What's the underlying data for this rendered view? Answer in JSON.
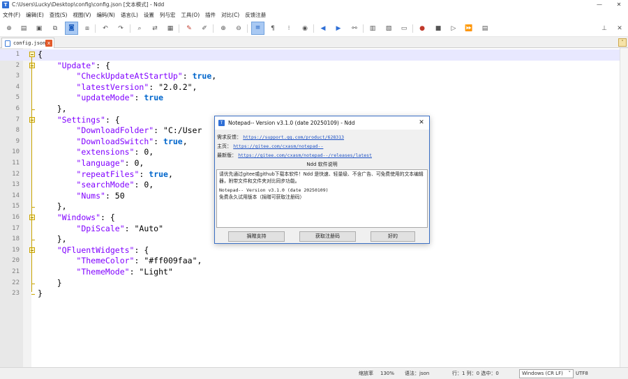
{
  "window": {
    "title": "C:\\Users\\Lucky\\Desktop\\config\\config.json [文本模式] - Ndd",
    "app_icon_letter": "T",
    "minimize_glyph": "—",
    "close_glyph": "✕"
  },
  "menu": [
    "文件(F)",
    "编辑(E)",
    "查找(S)",
    "视图(V)",
    "编码(N)",
    "语言(L)",
    "设置",
    "列与宏",
    "工具(O)",
    "插件",
    "对比(C)",
    "反馈注册"
  ],
  "toolbar_icons": [
    "new-file-icon",
    "open-file-icon",
    "save-icon",
    "save-all-icon",
    "close-icon",
    "close-all-icon",
    "undo-icon",
    "redo-icon",
    "find-icon",
    "replace-icon",
    "find-in-files-icon",
    "highlight-icon",
    "clear-highlight-icon",
    "zoom-in-icon",
    "zoom-out-icon",
    "word-wrap-icon",
    "show-symbols-icon",
    "indent-guide-icon",
    "macro-record-icon",
    "prev-icon",
    "next-icon",
    "compare-icon",
    "column-icon",
    "bookmark-icon",
    "monitor-icon",
    "record-icon",
    "stop-icon",
    "play-icon",
    "play-multiple-icon",
    "save-macro-icon",
    "pin-icon",
    "window-close-icon"
  ],
  "tab": {
    "label": "config.json",
    "close_glyph": "x",
    "dropdown_glyph": "˅"
  },
  "editor": {
    "lines": [
      {
        "n": "1",
        "text": "{"
      },
      {
        "n": "2",
        "text": "    \"Update\": {"
      },
      {
        "n": "3",
        "text": "        \"CheckUpdateAtStartUp\": true,"
      },
      {
        "n": "4",
        "text": "        \"latestVersion\": \"2.0.2\","
      },
      {
        "n": "5",
        "text": "        \"updateMode\": true"
      },
      {
        "n": "6",
        "text": "    },"
      },
      {
        "n": "7",
        "text": "    \"Settings\": {"
      },
      {
        "n": "8",
        "text": "        \"DownloadFolder\": \"C:/User"
      },
      {
        "n": "9",
        "text": "        \"DownloadSwitch\": true,"
      },
      {
        "n": "10",
        "text": "        \"extensions\": 0,"
      },
      {
        "n": "11",
        "text": "        \"language\": 0,"
      },
      {
        "n": "12",
        "text": "        \"repeatFiles\": true,"
      },
      {
        "n": "13",
        "text": "        \"searchMode\": 0,"
      },
      {
        "n": "14",
        "text": "        \"Nums\": 50"
      },
      {
        "n": "15",
        "text": "    },"
      },
      {
        "n": "16",
        "text": "    \"Windows\": {"
      },
      {
        "n": "17",
        "text": "        \"DpiScale\": \"Auto\""
      },
      {
        "n": "18",
        "text": "    },"
      },
      {
        "n": "19",
        "text": "    \"QFluentWidgets\": {"
      },
      {
        "n": "20",
        "text": "        \"ThemeColor\": \"#ff009faa\","
      },
      {
        "n": "21",
        "text": "        \"ThemeMode\": \"Light\""
      },
      {
        "n": "22",
        "text": "    }"
      },
      {
        "n": "23",
        "text": "}"
      }
    ],
    "colors": {
      "key": "#8000ff",
      "bool": "#0066cc",
      "current_line": "#e8e8ff",
      "fold_marker": "#c9a400"
    }
  },
  "dialog": {
    "title": "Notepad-- Version v3.1.0 (date 20250109) - Ndd",
    "close_glyph": "✕",
    "feedback_label": "需求反馈：",
    "feedback_url": "https://support.qq.com/product/628313",
    "home_label": "主页：",
    "home_url": "https://gitee.com/cxasm/notepad--",
    "latest_label": "最新版：",
    "latest_url": "https://gitee.com/cxasm/notepad--/releases/latest",
    "heading": "Ndd 软件说明",
    "body_line1": "请优先通过gitee或github下载本软件！Ndd 是快速、轻量级、不含广告、可免费使用的文本编辑器，附带文件和文件夹对比同步功能。",
    "body_line2": "Notepad-- Version v3.1.0 (date 20250109)",
    "body_line3": "免费永久试用版本（捐赠可获取注册码）",
    "buttons": [
      "捐赠支持",
      "获取注册码",
      "好的"
    ]
  },
  "status": {
    "zoom_label": "缩放率",
    "zoom_value": "130%",
    "language": "语法：json",
    "position": "行：1 列：0 选中：0",
    "eol": "Windows (CR LF)",
    "eol_arrow": "˅",
    "encoding": "UTF8"
  }
}
